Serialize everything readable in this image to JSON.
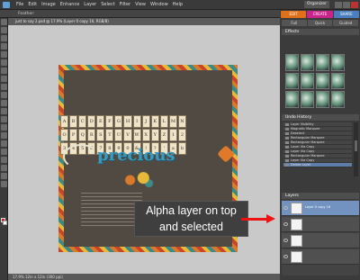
{
  "menubar": {
    "items": [
      "File",
      "Edit",
      "Image",
      "Enhance",
      "Layer",
      "Select",
      "Filter",
      "View",
      "Window",
      "Help"
    ],
    "organizer_label": "Organizer"
  },
  "options": {
    "feather_label": "Feather:"
  },
  "document": {
    "tab_title": "just to say 2.psd @ 17.9% (Layer 0 copy 16, RGB/8)",
    "status_text": "17.9%    12in x 12in (300 ppi)"
  },
  "modes": {
    "edit": "EDIT",
    "create": "CREATE",
    "share": "SHARE"
  },
  "subtabs": {
    "full": "Full",
    "quick": "Quick",
    "guided": "Guided"
  },
  "panels": {
    "effects": "Effects",
    "undo_history": "Undo History",
    "layers": "Layers"
  },
  "undo_items": [
    "Layer Visibility",
    "Magnetic Marquee",
    "Deselect",
    "Rectangular Marquee",
    "Rectangular Marquee",
    "Layer Via Copy",
    "Layer Via Copy",
    "Rectangular Marquee",
    "Layer Via Copy",
    "Delete Layer"
  ],
  "layers": [
    {
      "name": "Layer 0 copy 16",
      "selected": true
    },
    {
      "name": "",
      "selected": false
    },
    {
      "name": "",
      "selected": false
    },
    {
      "name": "",
      "selected": false
    }
  ],
  "letter_tiles": [
    "A",
    "B",
    "C",
    "D",
    "E",
    "F",
    "G",
    "H",
    "I",
    "J",
    "K",
    "L",
    "M",
    "N",
    "O",
    "P",
    "Q",
    "R",
    "S",
    "T",
    "U",
    "V",
    "W",
    "X",
    "Y",
    "Z",
    "1",
    "2",
    "3",
    "4",
    "5",
    "6",
    "7",
    "8",
    "9",
    "0",
    "&",
    "!",
    "?",
    "'",
    "a",
    "b"
  ],
  "scrapbook_title": "precious",
  "callout": {
    "line1": "Alpha layer on top",
    "line2": "and selected"
  },
  "colors": {
    "arrow": "#ee1111",
    "edit_mode": "#e0701a",
    "create_mode": "#c8248a",
    "share_mode": "#4a7fbf",
    "selection": "#7292c0"
  }
}
